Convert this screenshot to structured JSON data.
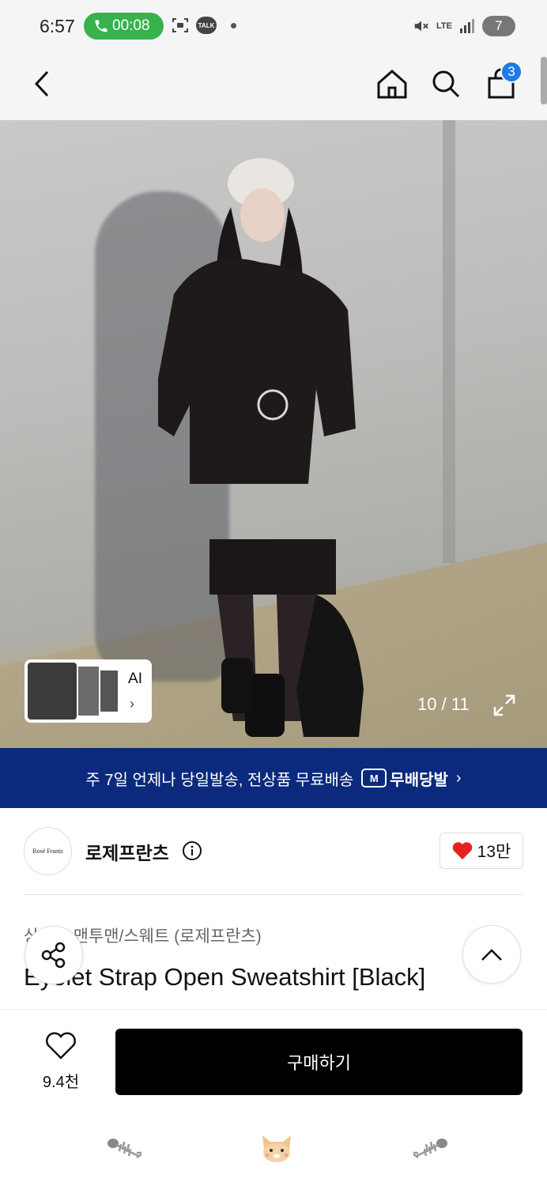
{
  "status_bar": {
    "time": "6:57",
    "call_timer": "00:08",
    "talk_badge": "TALK",
    "network": "LTE",
    "battery": "7"
  },
  "header": {
    "cart_count": "3",
    "icons": [
      "back-arrow-icon",
      "home-icon",
      "search-icon",
      "shopping-bag-icon"
    ]
  },
  "gallery": {
    "ai_label": "AI",
    "ai_chevron": "›",
    "counter": "10 / 11"
  },
  "banner": {
    "text": "주 7일 언제나 당일발송, 전상품 무료배송",
    "logo_box": "M",
    "logo_text": "무배당발",
    "chevron": "›",
    "background": "#0b2a7d"
  },
  "brand": {
    "logo_text": "Rosé Frantz",
    "name": "로제프란츠",
    "likes": "13만"
  },
  "product": {
    "category": "상의 > 맨투맨/스웨트 (로제프란츠)",
    "title": "Eyelet Strap Open Sweatshirt [Black]"
  },
  "bottom": {
    "wish_count": "9.4천",
    "buy_label": "구매하기"
  },
  "colors": {
    "accent": "#1e7be6",
    "call_green": "#37b24d",
    "heart_red": "#e52222"
  }
}
